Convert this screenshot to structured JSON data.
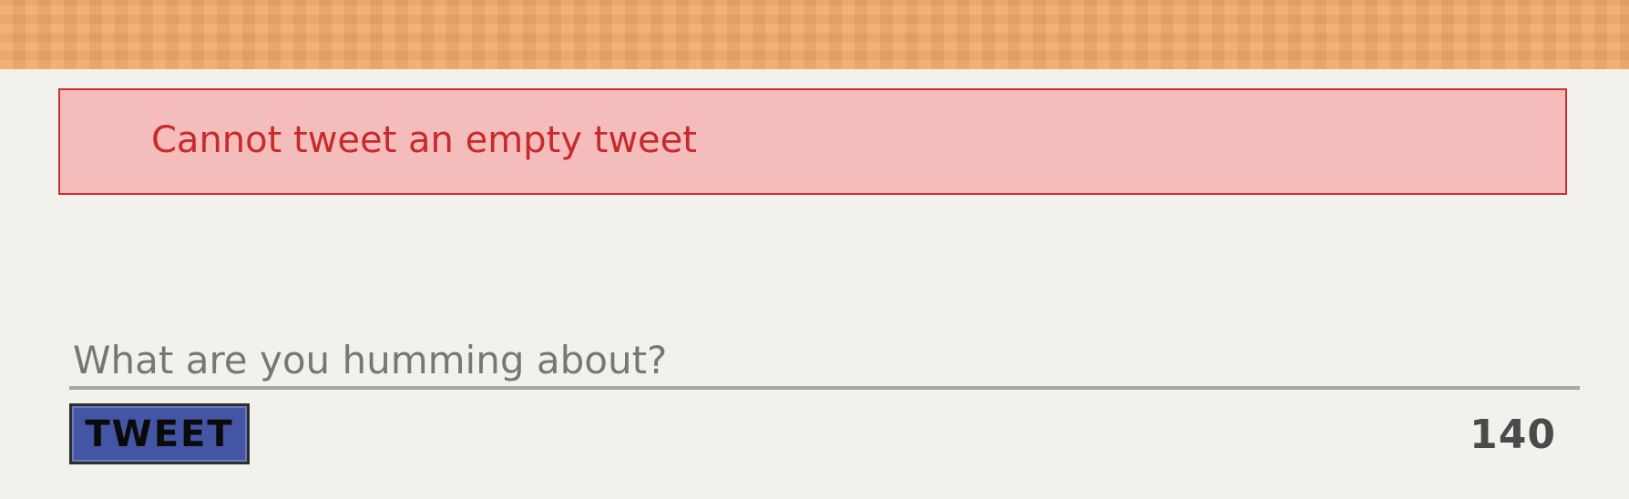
{
  "header": {
    "color": "#f0a866"
  },
  "alert": {
    "message": "Cannot tweet an empty tweet",
    "background": "#f5bcbc",
    "border": "#cc2f2f",
    "text_color": "#c82a2a"
  },
  "composer": {
    "placeholder": "What are you humming about?",
    "value": "",
    "button_label": "TWEET",
    "button_color": "#4456a3",
    "char_count": "140"
  }
}
